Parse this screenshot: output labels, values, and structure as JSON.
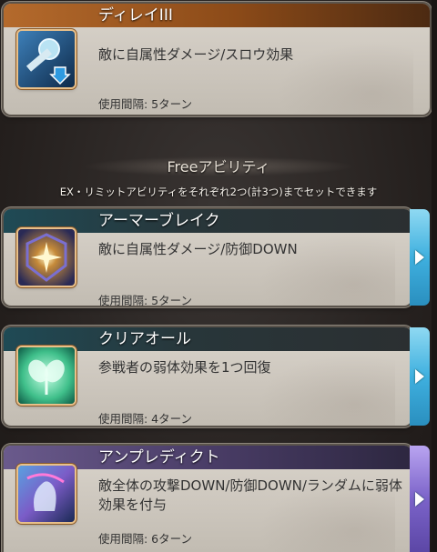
{
  "cards": [
    {
      "title": "ディレイIII",
      "description": "敵に自属性ダメージ/スロウ効果",
      "cooldown": "使用間隔: 5ターン",
      "icon": "delay-hourglass-icon",
      "title_color": "#b46a2c"
    },
    {
      "title": "アーマーブレイク",
      "description": "敵に自属性ダメージ/防御DOWN",
      "cooldown": "使用間隔: 5ターン",
      "icon": "armor-break-icon",
      "title_color": "#1f4a55"
    },
    {
      "title": "クリアオール",
      "description": "参戦者の弱体効果を1つ回復",
      "cooldown": "使用間隔: 4ターン",
      "icon": "clover-leaf-icon",
      "title_color": "#1f4a55"
    },
    {
      "title": "アンプレディクト",
      "description": "敵全体の攻撃DOWN/防御DOWN/ランダムに弱体効果を付与",
      "cooldown": "使用間隔: 6ターン",
      "icon": "hand-spell-icon",
      "title_color": "#6a5a8c"
    }
  ],
  "section": {
    "header": "Freeアビリティ",
    "note": "EX・リミットアビリティをそれぞれ2つ(計3つ)までセットできます"
  },
  "colors": {
    "side_tab_blue": "#3fb0df",
    "side_tab_purple": "#7b63c9",
    "card_bg": "#d9d4cb"
  }
}
